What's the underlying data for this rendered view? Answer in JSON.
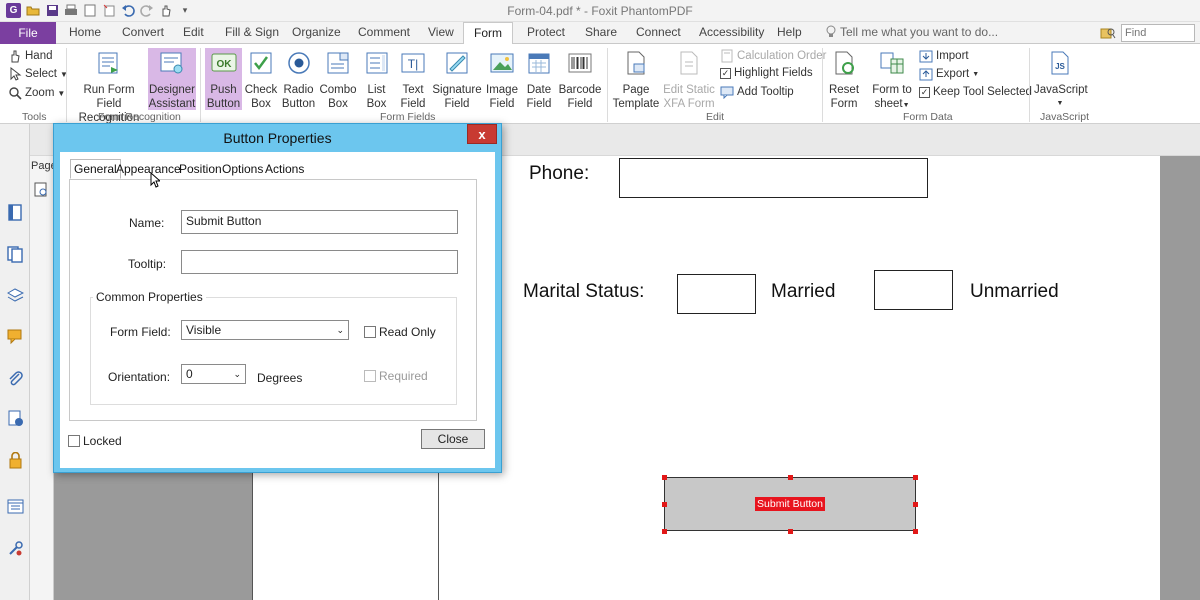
{
  "window": {
    "title": "Form-04.pdf * - Foxit PhantomPDF"
  },
  "menu": {
    "file": "File",
    "tabs": [
      "Home",
      "Convert",
      "Edit",
      "Fill & Sign",
      "Organize",
      "Comment",
      "View",
      "Form",
      "Protect",
      "Share",
      "Connect",
      "Accessibility",
      "Help"
    ],
    "active_tab": "Form",
    "tell_me": "Tell me what you want to do...",
    "find_placeholder": "Find"
  },
  "ribbon": {
    "tools": {
      "hand": "Hand",
      "select": "Select",
      "zoom": "Zoom",
      "group": "Tools"
    },
    "form_recognition": {
      "run_line1": "Run Form Field",
      "run_line2": "Recognition",
      "designer_line1": "Designer",
      "designer_line2": "Assistant",
      "group": "Form Recognition"
    },
    "form_fields": {
      "push_line1": "Push",
      "push_line2": "Button",
      "check_line1": "Check",
      "check_line2": "Box",
      "radio_line1": "Radio",
      "radio_line2": "Button",
      "combo_line1": "Combo",
      "combo_line2": "Box",
      "list_line1": "List",
      "list_line2": "Box",
      "text_line1": "Text",
      "text_line2": "Field",
      "sig_line1": "Signature",
      "sig_line2": "Field",
      "image_line1": "Image",
      "image_line2": "Field",
      "date_line1": "Date",
      "date_line2": "Field",
      "barcode_line1": "Barcode",
      "barcode_line2": "Field",
      "group": "Form Fields"
    },
    "edit": {
      "page_line1": "Page",
      "page_line2": "Template",
      "xfa_line1": "Edit Static",
      "xfa_line2": "XFA Form",
      "calc_order": "Calculation Order",
      "highlight_fields": "Highlight Fields",
      "add_tooltip": "Add Tooltip",
      "group": "Edit"
    },
    "form_data": {
      "reset_line1": "Reset",
      "reset_line2": "Form",
      "tosheet_line1": "Form to",
      "tosheet_line2": "sheet",
      "import": "Import",
      "export": "Export",
      "keep_tool": "Keep Tool Selected",
      "group": "Form Data"
    },
    "javascript": {
      "label": "JavaScript",
      "group": "JavaScript"
    }
  },
  "panel": {
    "pages_tab": "Page"
  },
  "document": {
    "phone_label": "Phone:",
    "marital_label": "Marital Status:",
    "married_label": "Married",
    "unmarried_label": "Unmarried",
    "submit_button_text": "Submit Button"
  },
  "dialog": {
    "title": "Button Properties",
    "close_symbol": "x",
    "tabs": [
      "General",
      "Appearance",
      "Position",
      "Options",
      "Actions"
    ],
    "active_tab": "General",
    "name_label": "Name:",
    "name_value": "Submit Button",
    "tooltip_label": "Tooltip:",
    "tooltip_value": "",
    "common_properties": "Common Properties",
    "form_field_label": "Form Field:",
    "form_field_value": "Visible",
    "read_only": "Read Only",
    "orientation_label": "Orientation:",
    "orientation_value": "0",
    "degrees": "Degrees",
    "required": "Required",
    "locked": "Locked",
    "close_button": "Close"
  }
}
